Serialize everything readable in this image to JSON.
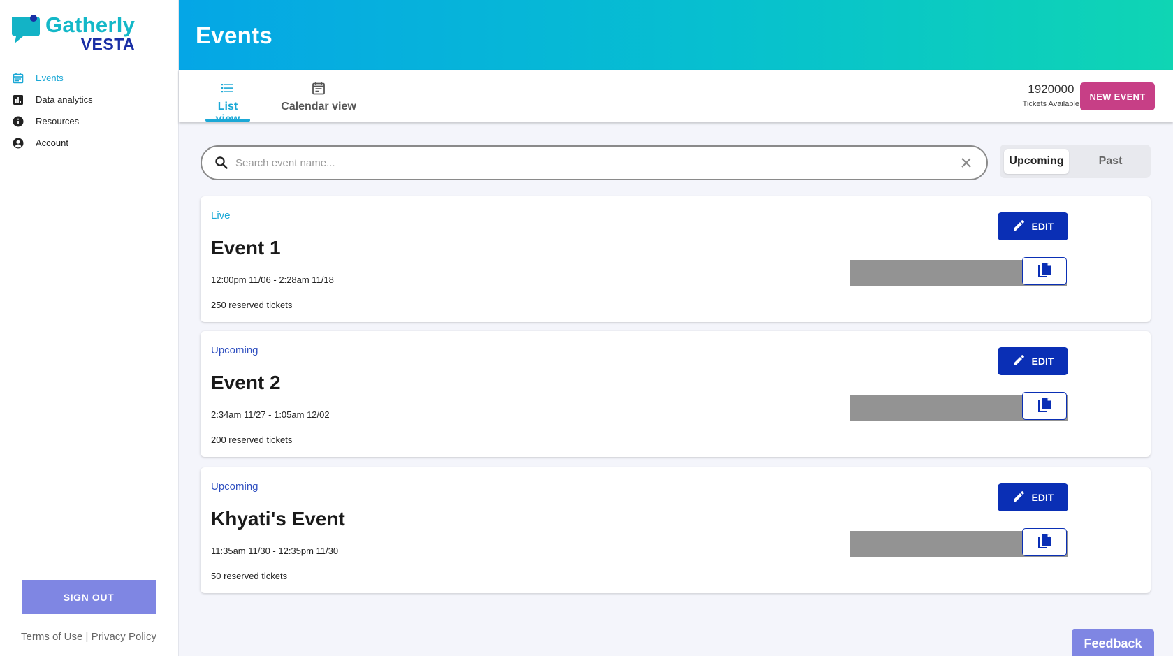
{
  "brand": {
    "line1": "Gatherly",
    "line2": "VESTA"
  },
  "sidebar": {
    "items": [
      {
        "label": "Events",
        "icon": "calendar-icon"
      },
      {
        "label": "Data analytics",
        "icon": "bar-chart-icon"
      },
      {
        "label": "Resources",
        "icon": "info-icon"
      },
      {
        "label": "Account",
        "icon": "account-circle-icon"
      }
    ],
    "signout_label": "SIGN OUT",
    "terms_label": "Terms of Use",
    "separator": "|",
    "privacy_label": "Privacy Policy"
  },
  "header": {
    "title": "Events"
  },
  "tabs": {
    "list_label": "List view",
    "calendar_label": "Calendar view",
    "tickets_count": "1920000",
    "tickets_label": "Tickets Available",
    "new_event_label": "NEW EVENT"
  },
  "search": {
    "placeholder": "Search event name...",
    "value": ""
  },
  "filter": {
    "upcoming_label": "Upcoming",
    "past_label": "Past",
    "selected": "Upcoming"
  },
  "events": [
    {
      "status": "Live",
      "title": "Event 1",
      "dates": "12:00pm 11/06 - 2:28am 11/18",
      "reserved": "250 reserved tickets",
      "edit_label": "EDIT"
    },
    {
      "status": "Upcoming",
      "title": "Event 2",
      "dates": "2:34am 11/27 - 1:05am 12/02",
      "reserved": "200 reserved tickets",
      "edit_label": "EDIT"
    },
    {
      "status": "Upcoming",
      "title": "Khyati's Event",
      "dates": "11:35am 11/30 - 12:35pm 11/30",
      "reserved": "50 reserved tickets",
      "edit_label": "EDIT"
    }
  ],
  "feedback_label": "Feedback",
  "colors": {
    "accent": "#1ba8d6",
    "primary": "#0a2fb5",
    "new_event": "#c73f86",
    "signout": "#7f86e3",
    "live": "#1ba8d6",
    "upcoming": "#2f4fc0"
  }
}
